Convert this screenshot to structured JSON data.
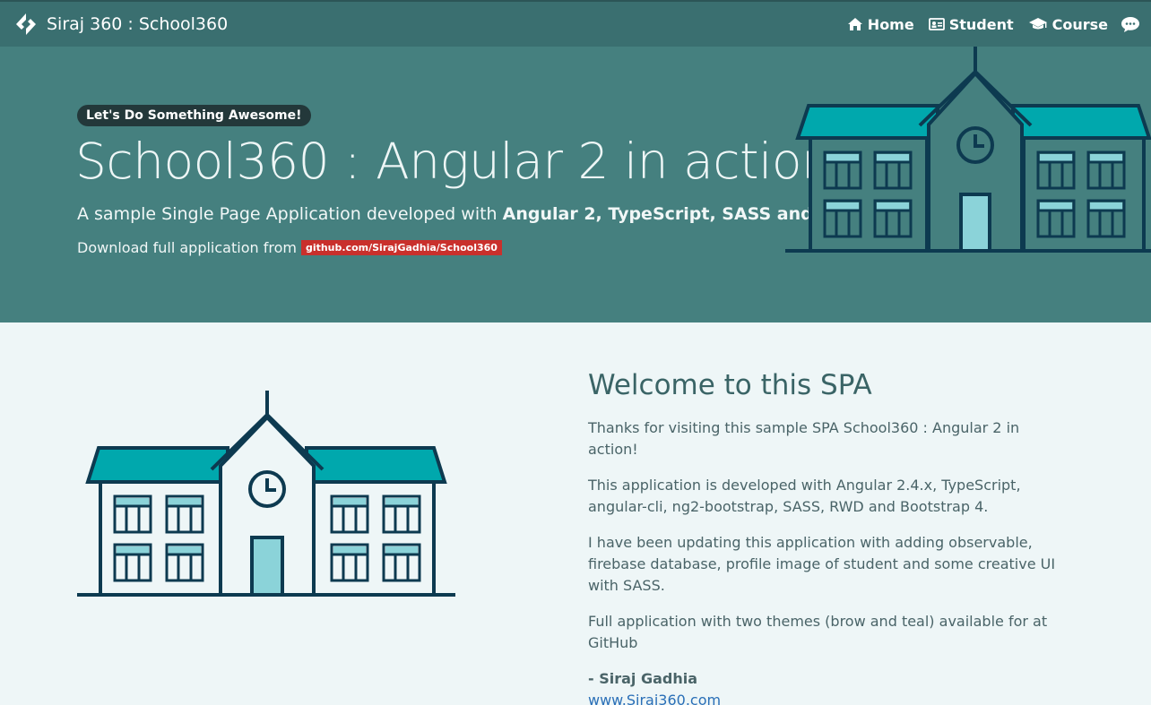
{
  "brand": {
    "title": "Siraj 360 : School360",
    "logo_icon": "brand-diamond-icon"
  },
  "nav": {
    "home": "Home",
    "student": "Student",
    "course": "Course",
    "chat_icon": "chat-bubble-icon"
  },
  "hero": {
    "badge": "Let's Do Something Awesome!",
    "title": "School360 : Angular 2 in action!",
    "subtitle_prefix": "A sample Single Page Application developed with ",
    "subtitle_bold": "Angular 2, TypeScript, SASS and Bootstrap 4",
    "subtitle_suffix": ".",
    "download_text": "Download full application from",
    "download_link": "github.com/SirajGadhia/School360"
  },
  "welcome": {
    "heading": "Welcome to this SPA",
    "p1": "Thanks for visiting this sample SPA School360 : Angular 2 in action!",
    "p2": "This application is developed with Angular 2.4.x, TypeScript, angular-cli, ng2-bootstrap, SASS, RWD and Bootstrap 4.",
    "p3": "I have been updating this application with adding observable, firebase database, profile image of student and some creative UI with SASS.",
    "p4": "Full application with two themes (brow and teal) available for at GitHub",
    "signature": "- Siraj Gadhia",
    "website": "www.Siraj360.com"
  },
  "colors": {
    "navbar": "#3a6f70",
    "hero": "#45807f",
    "content_bg": "#eef6f7",
    "roof": "#00a8ad",
    "outline": "#0d3a50",
    "window": "#8bd3d9",
    "link_badge": "#c9302c"
  }
}
